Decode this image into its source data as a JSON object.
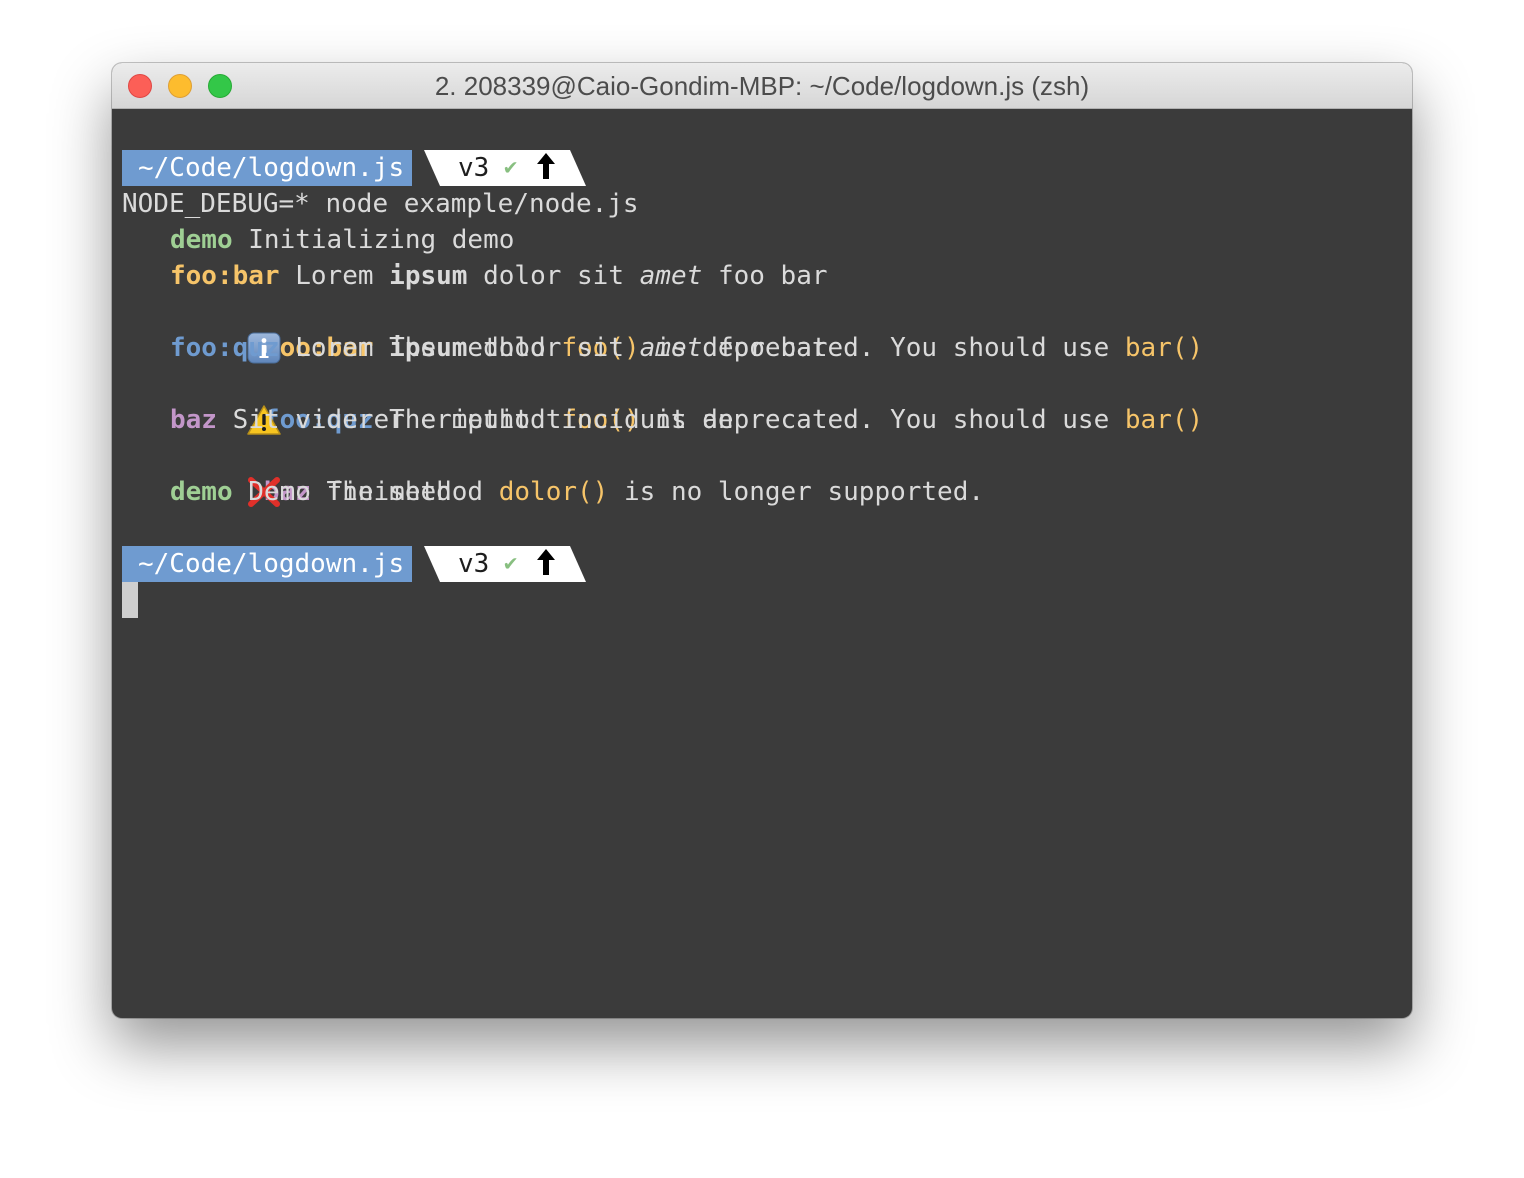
{
  "window": {
    "title": "2. 208339@Caio-Gondim-MBP: ~/Code/logdown.js (zsh)"
  },
  "prompt": {
    "path": "~/Code/logdown.js",
    "branch": "v3",
    "check": "✔",
    "arrow": "🠉"
  },
  "command": "NODE_DEBUG=* node example/node.js",
  "output": [
    {
      "ns": "demo",
      "text": "Initializing demo"
    },
    {
      "ns": "foo:bar",
      "t1": "Lorem",
      "b1": "ipsum",
      "t2": "dolor sit",
      "i1": "amet",
      "t3": "foo bar"
    },
    {
      "icon": "info-icon",
      "ns": "foo:bar",
      "t1": "The method",
      "h1": "foo()",
      "t2": "is deprecated. You should use",
      "h2": "bar()"
    },
    {
      "ns": "foo:quz",
      "t1": "Lorem",
      "b1": "ipsum",
      "t2": "dolor sit",
      "i1": "amet",
      "t3": "foo bar"
    },
    {
      "icon": "warning-icon",
      "ns": "foo:quz",
      "t1": "The method",
      "h1": "foo()",
      "t2": "is deprecated. You should use",
      "h2": "bar()"
    },
    {
      "ns": "baz",
      "text": "Sit viderer eripuit tincidunt an"
    },
    {
      "icon": "error-icon",
      "ns": "baz",
      "t1": "The method",
      "h1": "dolor()",
      "t2": "is no longer supported."
    },
    {
      "ns": "demo",
      "text": "Demo finished"
    }
  ],
  "colors": {
    "terminal_bg": "#3b3b3b",
    "text": "#dadada",
    "path_segment": "#6f9bd0",
    "demo": "#9fcf94",
    "foo_bar": "#f6c469",
    "foo_quz": "#6f9bd0",
    "baz": "#c396c9"
  }
}
